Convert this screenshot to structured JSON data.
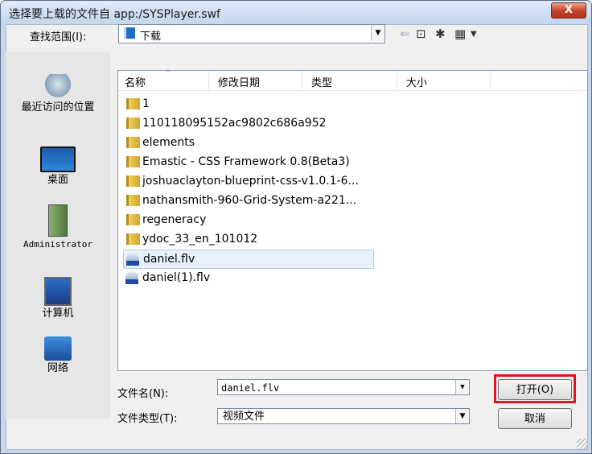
{
  "window": {
    "title": "选择要上载的文件自 app:/SYSPlayer.swf",
    "close_label": "X"
  },
  "lookin": {
    "label": "查找范围(I):",
    "value": "下载"
  },
  "toolbar": {
    "back_icon": "back-arrow-icon",
    "up_icon": "up-folder-icon",
    "new_folder_icon": "new-folder-icon",
    "view_icon": "view-menu-icon"
  },
  "places": [
    {
      "label": "最近访问的位置",
      "icon": "recent-places-icon"
    },
    {
      "label": "桌面",
      "icon": "desktop-icon"
    },
    {
      "label": "Administrator",
      "icon": "user-folder-icon"
    },
    {
      "label": "计算机",
      "icon": "computer-icon"
    },
    {
      "label": "网络",
      "icon": "network-icon"
    }
  ],
  "columns": [
    "名称",
    "修改日期",
    "类型",
    "大小"
  ],
  "files": [
    {
      "name": "1",
      "type": "folder"
    },
    {
      "name": "110118095152ac9802c686a952",
      "type": "folder"
    },
    {
      "name": "elements",
      "type": "folder"
    },
    {
      "name": "Emastic - CSS Framework 0.8(Beta3)",
      "type": "folder"
    },
    {
      "name": "joshuaclayton-blueprint-css-v1.0.1-6...",
      "type": "folder"
    },
    {
      "name": "nathansmith-960-Grid-System-a221...",
      "type": "folder"
    },
    {
      "name": "regeneracy",
      "type": "folder"
    },
    {
      "name": "ydoc_33_en_101012",
      "type": "folder"
    },
    {
      "name": "daniel.flv",
      "type": "flv",
      "selected": true
    },
    {
      "name": "daniel(1).flv",
      "type": "flv"
    }
  ],
  "filename": {
    "label": "文件名(N):",
    "value": "daniel.flv"
  },
  "filetype": {
    "label": "文件类型(T):",
    "value": "视频文件"
  },
  "buttons": {
    "open": "打开(O)",
    "cancel": "取消"
  },
  "colors": {
    "highlight": "#e0141e",
    "selection": "#e8f1fb"
  }
}
